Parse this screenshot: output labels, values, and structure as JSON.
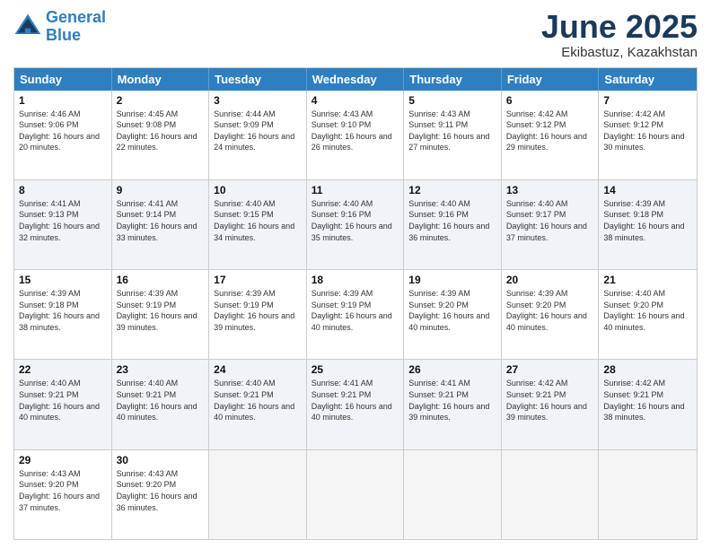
{
  "logo": {
    "line1": "General",
    "line2": "Blue"
  },
  "title": "June 2025",
  "location": "Ekibastuz, Kazakhstan",
  "weekdays": [
    "Sunday",
    "Monday",
    "Tuesday",
    "Wednesday",
    "Thursday",
    "Friday",
    "Saturday"
  ],
  "rows": [
    [
      {
        "day": "1",
        "sunrise": "Sunrise: 4:46 AM",
        "sunset": "Sunset: 9:06 PM",
        "daylight": "Daylight: 16 hours and 20 minutes."
      },
      {
        "day": "2",
        "sunrise": "Sunrise: 4:45 AM",
        "sunset": "Sunset: 9:08 PM",
        "daylight": "Daylight: 16 hours and 22 minutes."
      },
      {
        "day": "3",
        "sunrise": "Sunrise: 4:44 AM",
        "sunset": "Sunset: 9:09 PM",
        "daylight": "Daylight: 16 hours and 24 minutes."
      },
      {
        "day": "4",
        "sunrise": "Sunrise: 4:43 AM",
        "sunset": "Sunset: 9:10 PM",
        "daylight": "Daylight: 16 hours and 26 minutes."
      },
      {
        "day": "5",
        "sunrise": "Sunrise: 4:43 AM",
        "sunset": "Sunset: 9:11 PM",
        "daylight": "Daylight: 16 hours and 27 minutes."
      },
      {
        "day": "6",
        "sunrise": "Sunrise: 4:42 AM",
        "sunset": "Sunset: 9:12 PM",
        "daylight": "Daylight: 16 hours and 29 minutes."
      },
      {
        "day": "7",
        "sunrise": "Sunrise: 4:42 AM",
        "sunset": "Sunset: 9:12 PM",
        "daylight": "Daylight: 16 hours and 30 minutes."
      }
    ],
    [
      {
        "day": "8",
        "sunrise": "Sunrise: 4:41 AM",
        "sunset": "Sunset: 9:13 PM",
        "daylight": "Daylight: 16 hours and 32 minutes."
      },
      {
        "day": "9",
        "sunrise": "Sunrise: 4:41 AM",
        "sunset": "Sunset: 9:14 PM",
        "daylight": "Daylight: 16 hours and 33 minutes."
      },
      {
        "day": "10",
        "sunrise": "Sunrise: 4:40 AM",
        "sunset": "Sunset: 9:15 PM",
        "daylight": "Daylight: 16 hours and 34 minutes."
      },
      {
        "day": "11",
        "sunrise": "Sunrise: 4:40 AM",
        "sunset": "Sunset: 9:16 PM",
        "daylight": "Daylight: 16 hours and 35 minutes."
      },
      {
        "day": "12",
        "sunrise": "Sunrise: 4:40 AM",
        "sunset": "Sunset: 9:16 PM",
        "daylight": "Daylight: 16 hours and 36 minutes."
      },
      {
        "day": "13",
        "sunrise": "Sunrise: 4:40 AM",
        "sunset": "Sunset: 9:17 PM",
        "daylight": "Daylight: 16 hours and 37 minutes."
      },
      {
        "day": "14",
        "sunrise": "Sunrise: 4:39 AM",
        "sunset": "Sunset: 9:18 PM",
        "daylight": "Daylight: 16 hours and 38 minutes."
      }
    ],
    [
      {
        "day": "15",
        "sunrise": "Sunrise: 4:39 AM",
        "sunset": "Sunset: 9:18 PM",
        "daylight": "Daylight: 16 hours and 38 minutes."
      },
      {
        "day": "16",
        "sunrise": "Sunrise: 4:39 AM",
        "sunset": "Sunset: 9:19 PM",
        "daylight": "Daylight: 16 hours and 39 minutes."
      },
      {
        "day": "17",
        "sunrise": "Sunrise: 4:39 AM",
        "sunset": "Sunset: 9:19 PM",
        "daylight": "Daylight: 16 hours and 39 minutes."
      },
      {
        "day": "18",
        "sunrise": "Sunrise: 4:39 AM",
        "sunset": "Sunset: 9:19 PM",
        "daylight": "Daylight: 16 hours and 40 minutes."
      },
      {
        "day": "19",
        "sunrise": "Sunrise: 4:39 AM",
        "sunset": "Sunset: 9:20 PM",
        "daylight": "Daylight: 16 hours and 40 minutes."
      },
      {
        "day": "20",
        "sunrise": "Sunrise: 4:39 AM",
        "sunset": "Sunset: 9:20 PM",
        "daylight": "Daylight: 16 hours and 40 minutes."
      },
      {
        "day": "21",
        "sunrise": "Sunrise: 4:40 AM",
        "sunset": "Sunset: 9:20 PM",
        "daylight": "Daylight: 16 hours and 40 minutes."
      }
    ],
    [
      {
        "day": "22",
        "sunrise": "Sunrise: 4:40 AM",
        "sunset": "Sunset: 9:21 PM",
        "daylight": "Daylight: 16 hours and 40 minutes."
      },
      {
        "day": "23",
        "sunrise": "Sunrise: 4:40 AM",
        "sunset": "Sunset: 9:21 PM",
        "daylight": "Daylight: 16 hours and 40 minutes."
      },
      {
        "day": "24",
        "sunrise": "Sunrise: 4:40 AM",
        "sunset": "Sunset: 9:21 PM",
        "daylight": "Daylight: 16 hours and 40 minutes."
      },
      {
        "day": "25",
        "sunrise": "Sunrise: 4:41 AM",
        "sunset": "Sunset: 9:21 PM",
        "daylight": "Daylight: 16 hours and 40 minutes."
      },
      {
        "day": "26",
        "sunrise": "Sunrise: 4:41 AM",
        "sunset": "Sunset: 9:21 PM",
        "daylight": "Daylight: 16 hours and 39 minutes."
      },
      {
        "day": "27",
        "sunrise": "Sunrise: 4:42 AM",
        "sunset": "Sunset: 9:21 PM",
        "daylight": "Daylight: 16 hours and 39 minutes."
      },
      {
        "day": "28",
        "sunrise": "Sunrise: 4:42 AM",
        "sunset": "Sunset: 9:21 PM",
        "daylight": "Daylight: 16 hours and 38 minutes."
      }
    ],
    [
      {
        "day": "29",
        "sunrise": "Sunrise: 4:43 AM",
        "sunset": "Sunset: 9:20 PM",
        "daylight": "Daylight: 16 hours and 37 minutes."
      },
      {
        "day": "30",
        "sunrise": "Sunrise: 4:43 AM",
        "sunset": "Sunset: 9:20 PM",
        "daylight": "Daylight: 16 hours and 36 minutes."
      },
      {
        "day": "",
        "sunrise": "",
        "sunset": "",
        "daylight": ""
      },
      {
        "day": "",
        "sunrise": "",
        "sunset": "",
        "daylight": ""
      },
      {
        "day": "",
        "sunrise": "",
        "sunset": "",
        "daylight": ""
      },
      {
        "day": "",
        "sunrise": "",
        "sunset": "",
        "daylight": ""
      },
      {
        "day": "",
        "sunrise": "",
        "sunset": "",
        "daylight": ""
      }
    ]
  ]
}
